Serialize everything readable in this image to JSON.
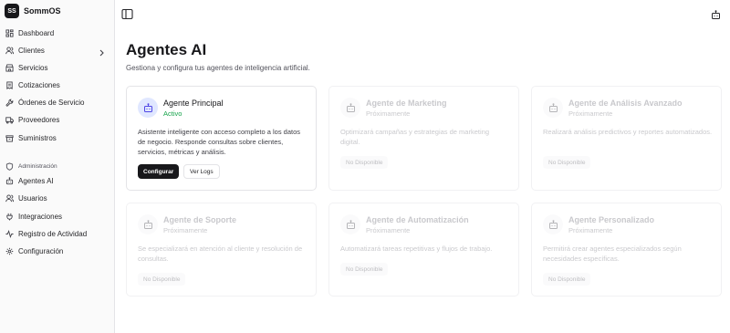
{
  "brand": {
    "logo": "SS",
    "name": "SommOS"
  },
  "sidebar": {
    "items": [
      {
        "label": "Dashboard",
        "icon": "dashboard-icon"
      },
      {
        "label": "Clientes",
        "icon": "users-icon"
      },
      {
        "label": "Servicios",
        "icon": "store-icon"
      },
      {
        "label": "Cotizaciones",
        "icon": "receipt-icon"
      },
      {
        "label": "Órdenes de Servicio",
        "icon": "wrench-icon"
      },
      {
        "label": "Proveedores",
        "icon": "truck-icon"
      },
      {
        "label": "Suministros",
        "icon": "package-icon"
      }
    ],
    "section_label": "Administración",
    "admin_items": [
      {
        "label": "Agentes AI",
        "icon": "robot-icon"
      },
      {
        "label": "Usuarios",
        "icon": "users-icon"
      },
      {
        "label": "Integraciones",
        "icon": "plug-icon"
      },
      {
        "label": "Registro de Actividad",
        "icon": "activity-icon"
      },
      {
        "label": "Configuración",
        "icon": "gear-icon"
      }
    ]
  },
  "page": {
    "title": "Agentes AI",
    "subtitle": "Gestiona y configura tus agentes de inteligencia artificial."
  },
  "cards": [
    {
      "title": "Agente Principal",
      "status": "Activo",
      "description": "Asistente inteligente con acceso completo a los datos de negocio. Responde consultas sobre clientes, servicios, métricas y análisis.",
      "primary_button": "Configurar",
      "secondary_button": "Ver Logs"
    },
    {
      "title": "Agente de Marketing",
      "status": "Próximamente",
      "description": "Optimizará campañas y estrategias de marketing digital.",
      "badge": "No Disponible"
    },
    {
      "title": "Agente de Análisis Avanzado",
      "status": "Próximamente",
      "description": "Realizará análisis predictivos y reportes automatizados.",
      "badge": "No Disponible"
    },
    {
      "title": "Agente de Soporte",
      "status": "Próximamente",
      "description": "Se especializará en atención al cliente y resolución de consultas.",
      "badge": "No Disponible"
    },
    {
      "title": "Agente de Automatización",
      "status": "Próximamente",
      "description": "Automatizará tareas repetitivas y flujos de trabajo.",
      "badge": "No Disponible"
    },
    {
      "title": "Agente Personalizado",
      "status": "Próximamente",
      "description": "Permitirá crear agentes especializados según necesidades específicas.",
      "badge": "No Disponible"
    }
  ],
  "colors": {
    "accent": "#18181b",
    "active": "#16a34a",
    "active_icon_bg": "#e0e7ff"
  }
}
